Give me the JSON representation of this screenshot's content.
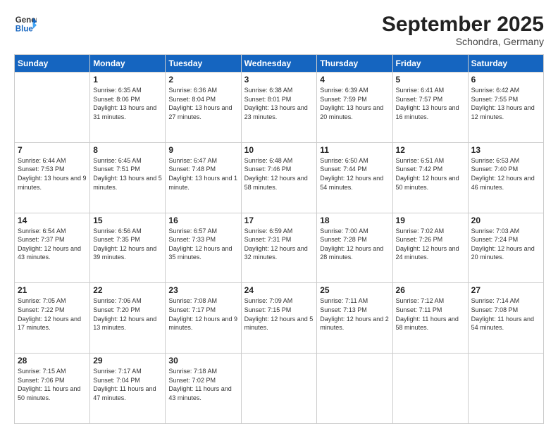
{
  "header": {
    "logo_line1": "General",
    "logo_line2": "Blue",
    "month": "September 2025",
    "location": "Schondra, Germany"
  },
  "weekdays": [
    "Sunday",
    "Monday",
    "Tuesday",
    "Wednesday",
    "Thursday",
    "Friday",
    "Saturday"
  ],
  "weeks": [
    [
      {
        "day": "",
        "info": ""
      },
      {
        "day": "1",
        "info": "Sunrise: 6:35 AM\nSunset: 8:06 PM\nDaylight: 13 hours\nand 31 minutes."
      },
      {
        "day": "2",
        "info": "Sunrise: 6:36 AM\nSunset: 8:04 PM\nDaylight: 13 hours\nand 27 minutes."
      },
      {
        "day": "3",
        "info": "Sunrise: 6:38 AM\nSunset: 8:01 PM\nDaylight: 13 hours\nand 23 minutes."
      },
      {
        "day": "4",
        "info": "Sunrise: 6:39 AM\nSunset: 7:59 PM\nDaylight: 13 hours\nand 20 minutes."
      },
      {
        "day": "5",
        "info": "Sunrise: 6:41 AM\nSunset: 7:57 PM\nDaylight: 13 hours\nand 16 minutes."
      },
      {
        "day": "6",
        "info": "Sunrise: 6:42 AM\nSunset: 7:55 PM\nDaylight: 13 hours\nand 12 minutes."
      }
    ],
    [
      {
        "day": "7",
        "info": "Sunrise: 6:44 AM\nSunset: 7:53 PM\nDaylight: 13 hours\nand 9 minutes."
      },
      {
        "day": "8",
        "info": "Sunrise: 6:45 AM\nSunset: 7:51 PM\nDaylight: 13 hours\nand 5 minutes."
      },
      {
        "day": "9",
        "info": "Sunrise: 6:47 AM\nSunset: 7:48 PM\nDaylight: 13 hours\nand 1 minute."
      },
      {
        "day": "10",
        "info": "Sunrise: 6:48 AM\nSunset: 7:46 PM\nDaylight: 12 hours\nand 58 minutes."
      },
      {
        "day": "11",
        "info": "Sunrise: 6:50 AM\nSunset: 7:44 PM\nDaylight: 12 hours\nand 54 minutes."
      },
      {
        "day": "12",
        "info": "Sunrise: 6:51 AM\nSunset: 7:42 PM\nDaylight: 12 hours\nand 50 minutes."
      },
      {
        "day": "13",
        "info": "Sunrise: 6:53 AM\nSunset: 7:40 PM\nDaylight: 12 hours\nand 46 minutes."
      }
    ],
    [
      {
        "day": "14",
        "info": "Sunrise: 6:54 AM\nSunset: 7:37 PM\nDaylight: 12 hours\nand 43 minutes."
      },
      {
        "day": "15",
        "info": "Sunrise: 6:56 AM\nSunset: 7:35 PM\nDaylight: 12 hours\nand 39 minutes."
      },
      {
        "day": "16",
        "info": "Sunrise: 6:57 AM\nSunset: 7:33 PM\nDaylight: 12 hours\nand 35 minutes."
      },
      {
        "day": "17",
        "info": "Sunrise: 6:59 AM\nSunset: 7:31 PM\nDaylight: 12 hours\nand 32 minutes."
      },
      {
        "day": "18",
        "info": "Sunrise: 7:00 AM\nSunset: 7:28 PM\nDaylight: 12 hours\nand 28 minutes."
      },
      {
        "day": "19",
        "info": "Sunrise: 7:02 AM\nSunset: 7:26 PM\nDaylight: 12 hours\nand 24 minutes."
      },
      {
        "day": "20",
        "info": "Sunrise: 7:03 AM\nSunset: 7:24 PM\nDaylight: 12 hours\nand 20 minutes."
      }
    ],
    [
      {
        "day": "21",
        "info": "Sunrise: 7:05 AM\nSunset: 7:22 PM\nDaylight: 12 hours\nand 17 minutes."
      },
      {
        "day": "22",
        "info": "Sunrise: 7:06 AM\nSunset: 7:20 PM\nDaylight: 12 hours\nand 13 minutes."
      },
      {
        "day": "23",
        "info": "Sunrise: 7:08 AM\nSunset: 7:17 PM\nDaylight: 12 hours\nand 9 minutes."
      },
      {
        "day": "24",
        "info": "Sunrise: 7:09 AM\nSunset: 7:15 PM\nDaylight: 12 hours\nand 5 minutes."
      },
      {
        "day": "25",
        "info": "Sunrise: 7:11 AM\nSunset: 7:13 PM\nDaylight: 12 hours\nand 2 minutes."
      },
      {
        "day": "26",
        "info": "Sunrise: 7:12 AM\nSunset: 7:11 PM\nDaylight: 11 hours\nand 58 minutes."
      },
      {
        "day": "27",
        "info": "Sunrise: 7:14 AM\nSunset: 7:08 PM\nDaylight: 11 hours\nand 54 minutes."
      }
    ],
    [
      {
        "day": "28",
        "info": "Sunrise: 7:15 AM\nSunset: 7:06 PM\nDaylight: 11 hours\nand 50 minutes."
      },
      {
        "day": "29",
        "info": "Sunrise: 7:17 AM\nSunset: 7:04 PM\nDaylight: 11 hours\nand 47 minutes."
      },
      {
        "day": "30",
        "info": "Sunrise: 7:18 AM\nSunset: 7:02 PM\nDaylight: 11 hours\nand 43 minutes."
      },
      {
        "day": "",
        "info": ""
      },
      {
        "day": "",
        "info": ""
      },
      {
        "day": "",
        "info": ""
      },
      {
        "day": "",
        "info": ""
      }
    ]
  ]
}
